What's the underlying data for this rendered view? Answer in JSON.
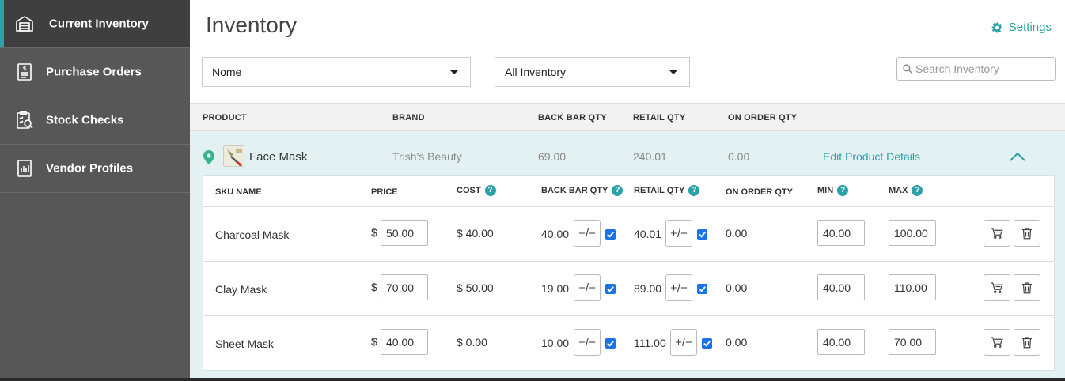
{
  "sidebar": {
    "items": [
      {
        "label": "Current Inventory",
        "icon": "warehouse-icon",
        "active": true
      },
      {
        "label": "Purchase Orders",
        "icon": "receipt-icon",
        "active": false
      },
      {
        "label": "Stock Checks",
        "icon": "clipboard-check-icon",
        "active": false
      },
      {
        "label": "Vendor Profiles",
        "icon": "vendor-icon",
        "active": false
      }
    ]
  },
  "header": {
    "title": "Inventory",
    "settings_label": "Settings"
  },
  "filters": {
    "vendor_selected": "Nome",
    "inventory_selected": "All Inventory",
    "search_placeholder": "Search Inventory",
    "search_value": ""
  },
  "table": {
    "columns": [
      "PRODUCT",
      "BRAND",
      "BACK BAR QTY",
      "RETAIL QTY",
      "ON ORDER QTY"
    ]
  },
  "product": {
    "name": "Face Mask",
    "brand": "Trish's Beauty",
    "back_bar_qty": "69.00",
    "retail_qty": "240.01",
    "on_order_qty": "0.00",
    "edit_label": "Edit Product Details"
  },
  "sku_table": {
    "columns": {
      "sku_name": "SKU NAME",
      "price": "PRICE",
      "cost": "COST",
      "back_bar_qty": "BACK BAR QTY",
      "retail_qty": "RETAIL QTY",
      "on_order_qty": "ON ORDER QTY",
      "min": "MIN",
      "max": "MAX"
    },
    "currency": "$",
    "adjust_symbol": "+/−",
    "rows": [
      {
        "name": "Charcoal Mask",
        "price": "50.00",
        "cost": "$ 40.00",
        "back_bar_qty": "40.00",
        "back_bar_checked": true,
        "retail_qty": "40.01",
        "retail_checked": true,
        "on_order_qty": "0.00",
        "min": "40.00",
        "max": "100.00"
      },
      {
        "name": "Clay Mask",
        "price": "70.00",
        "cost": "$ 50.00",
        "back_bar_qty": "19.00",
        "back_bar_checked": true,
        "retail_qty": "89.00",
        "retail_checked": true,
        "on_order_qty": "0.00",
        "min": "40.00",
        "max": "110.00"
      },
      {
        "name": "Sheet Mask",
        "price": "40.00",
        "cost": "$ 0.00",
        "back_bar_qty": "10.00",
        "back_bar_checked": true,
        "retail_qty": "111.00",
        "retail_checked": true,
        "on_order_qty": "0.00",
        "min": "40.00",
        "max": "70.00"
      }
    ]
  },
  "colors": {
    "accent": "#2ea0a8",
    "sidebar_bg": "#575757",
    "sidebar_active": "#3f3f3f",
    "product_row_bg": "#e3f1f2",
    "checkbox": "#1a73e8"
  }
}
